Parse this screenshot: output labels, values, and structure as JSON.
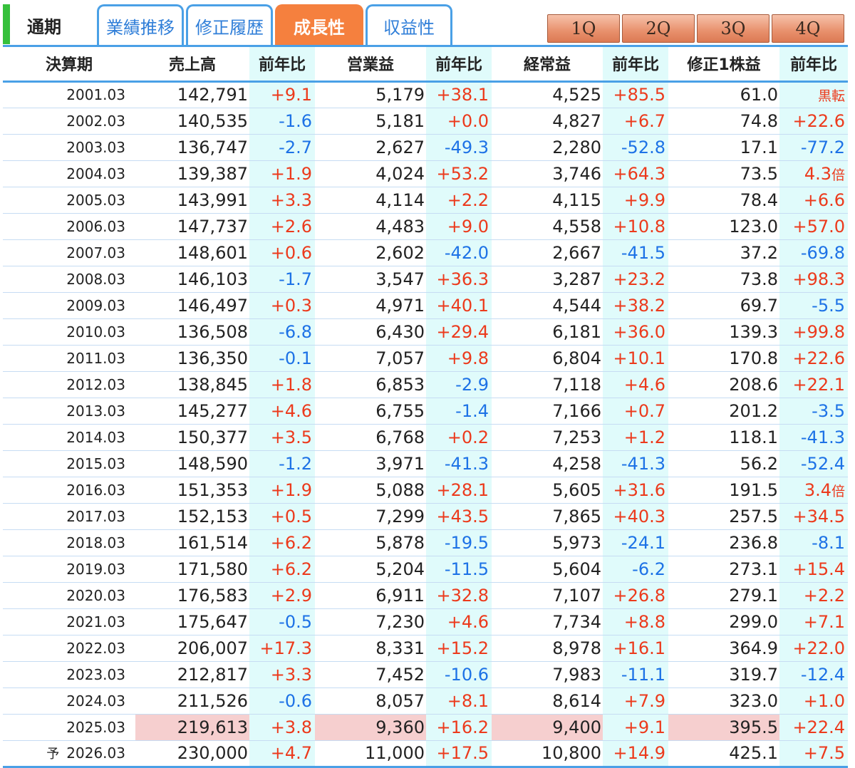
{
  "header": {
    "period_label": "通期",
    "tabs": [
      {
        "label": "業績推移",
        "active": false
      },
      {
        "label": "修正履歴",
        "active": false
      },
      {
        "label": "成長性",
        "active": true
      },
      {
        "label": "収益性",
        "active": false
      }
    ],
    "quarters": [
      "1Q",
      "2Q",
      "3Q",
      "4Q"
    ]
  },
  "colors": {
    "accent_blue": "#4aa0e6",
    "active_tab": "#f5803e",
    "positive": "#ec3a1c",
    "negative": "#1d72e6",
    "yoy_background": "#e0fbfb",
    "highlight_background": "#f6cfcf",
    "indicator_green": "#36c03c"
  },
  "table": {
    "columns": [
      "決算期",
      "売上高",
      "前年比",
      "営業益",
      "前年比",
      "経常益",
      "前年比",
      "修正1株益",
      "前年比"
    ],
    "rows": [
      {
        "period": "2001.03",
        "sales": "142,791",
        "sales_yoy": "+9.1",
        "op": "5,179",
        "op_yoy": "+38.1",
        "ord": "4,525",
        "ord_yoy": "+85.5",
        "eps": "61.0",
        "eps_yoy": "黒転"
      },
      {
        "period": "2002.03",
        "sales": "140,535",
        "sales_yoy": "-1.6",
        "op": "5,181",
        "op_yoy": "+0.0",
        "ord": "4,827",
        "ord_yoy": "+6.7",
        "eps": "74.8",
        "eps_yoy": "+22.6"
      },
      {
        "period": "2003.03",
        "sales": "136,747",
        "sales_yoy": "-2.7",
        "op": "2,627",
        "op_yoy": "-49.3",
        "ord": "2,280",
        "ord_yoy": "-52.8",
        "eps": "17.1",
        "eps_yoy": "-77.2"
      },
      {
        "period": "2004.03",
        "sales": "139,387",
        "sales_yoy": "+1.9",
        "op": "4,024",
        "op_yoy": "+53.2",
        "ord": "3,746",
        "ord_yoy": "+64.3",
        "eps": "73.5",
        "eps_yoy": "4.3倍"
      },
      {
        "period": "2005.03",
        "sales": "143,991",
        "sales_yoy": "+3.3",
        "op": "4,114",
        "op_yoy": "+2.2",
        "ord": "4,115",
        "ord_yoy": "+9.9",
        "eps": "78.4",
        "eps_yoy": "+6.6"
      },
      {
        "period": "2006.03",
        "sales": "147,737",
        "sales_yoy": "+2.6",
        "op": "4,483",
        "op_yoy": "+9.0",
        "ord": "4,558",
        "ord_yoy": "+10.8",
        "eps": "123.0",
        "eps_yoy": "+57.0"
      },
      {
        "period": "2007.03",
        "sales": "148,601",
        "sales_yoy": "+0.6",
        "op": "2,602",
        "op_yoy": "-42.0",
        "ord": "2,667",
        "ord_yoy": "-41.5",
        "eps": "37.2",
        "eps_yoy": "-69.8"
      },
      {
        "period": "2008.03",
        "sales": "146,103",
        "sales_yoy": "-1.7",
        "op": "3,547",
        "op_yoy": "+36.3",
        "ord": "3,287",
        "ord_yoy": "+23.2",
        "eps": "73.8",
        "eps_yoy": "+98.3"
      },
      {
        "period": "2009.03",
        "sales": "146,497",
        "sales_yoy": "+0.3",
        "op": "4,971",
        "op_yoy": "+40.1",
        "ord": "4,544",
        "ord_yoy": "+38.2",
        "eps": "69.7",
        "eps_yoy": "-5.5"
      },
      {
        "period": "2010.03",
        "sales": "136,508",
        "sales_yoy": "-6.8",
        "op": "6,430",
        "op_yoy": "+29.4",
        "ord": "6,181",
        "ord_yoy": "+36.0",
        "eps": "139.3",
        "eps_yoy": "+99.8"
      },
      {
        "period": "2011.03",
        "sales": "136,350",
        "sales_yoy": "-0.1",
        "op": "7,057",
        "op_yoy": "+9.8",
        "ord": "6,804",
        "ord_yoy": "+10.1",
        "eps": "170.8",
        "eps_yoy": "+22.6"
      },
      {
        "period": "2012.03",
        "sales": "138,845",
        "sales_yoy": "+1.8",
        "op": "6,853",
        "op_yoy": "-2.9",
        "ord": "7,118",
        "ord_yoy": "+4.6",
        "eps": "208.6",
        "eps_yoy": "+22.1"
      },
      {
        "period": "2013.03",
        "sales": "145,277",
        "sales_yoy": "+4.6",
        "op": "6,755",
        "op_yoy": "-1.4",
        "ord": "7,166",
        "ord_yoy": "+0.7",
        "eps": "201.2",
        "eps_yoy": "-3.5"
      },
      {
        "period": "2014.03",
        "sales": "150,377",
        "sales_yoy": "+3.5",
        "op": "6,768",
        "op_yoy": "+0.2",
        "ord": "7,253",
        "ord_yoy": "+1.2",
        "eps": "118.1",
        "eps_yoy": "-41.3"
      },
      {
        "period": "2015.03",
        "sales": "148,590",
        "sales_yoy": "-1.2",
        "op": "3,971",
        "op_yoy": "-41.3",
        "ord": "4,258",
        "ord_yoy": "-41.3",
        "eps": "56.2",
        "eps_yoy": "-52.4"
      },
      {
        "period": "2016.03",
        "sales": "151,353",
        "sales_yoy": "+1.9",
        "op": "5,088",
        "op_yoy": "+28.1",
        "ord": "5,605",
        "ord_yoy": "+31.6",
        "eps": "191.5",
        "eps_yoy": "3.4倍"
      },
      {
        "period": "2017.03",
        "sales": "152,153",
        "sales_yoy": "+0.5",
        "op": "7,299",
        "op_yoy": "+43.5",
        "ord": "7,865",
        "ord_yoy": "+40.3",
        "eps": "257.5",
        "eps_yoy": "+34.5"
      },
      {
        "period": "2018.03",
        "sales": "161,514",
        "sales_yoy": "+6.2",
        "op": "5,878",
        "op_yoy": "-19.5",
        "ord": "5,973",
        "ord_yoy": "-24.1",
        "eps": "236.8",
        "eps_yoy": "-8.1"
      },
      {
        "period": "2019.03",
        "sales": "171,580",
        "sales_yoy": "+6.2",
        "op": "5,204",
        "op_yoy": "-11.5",
        "ord": "5,604",
        "ord_yoy": "-6.2",
        "eps": "273.1",
        "eps_yoy": "+15.4"
      },
      {
        "period": "2020.03",
        "sales": "176,583",
        "sales_yoy": "+2.9",
        "op": "6,911",
        "op_yoy": "+32.8",
        "ord": "7,107",
        "ord_yoy": "+26.8",
        "eps": "279.1",
        "eps_yoy": "+2.2"
      },
      {
        "period": "2021.03",
        "sales": "175,647",
        "sales_yoy": "-0.5",
        "op": "7,230",
        "op_yoy": "+4.6",
        "ord": "7,734",
        "ord_yoy": "+8.8",
        "eps": "299.0",
        "eps_yoy": "+7.1"
      },
      {
        "period": "2022.03",
        "sales": "206,007",
        "sales_yoy": "+17.3",
        "op": "8,331",
        "op_yoy": "+15.2",
        "ord": "8,978",
        "ord_yoy": "+16.1",
        "eps": "364.9",
        "eps_yoy": "+22.0"
      },
      {
        "period": "2023.03",
        "sales": "212,817",
        "sales_yoy": "+3.3",
        "op": "7,452",
        "op_yoy": "-10.6",
        "ord": "7,983",
        "ord_yoy": "-11.1",
        "eps": "319.7",
        "eps_yoy": "-12.4"
      },
      {
        "period": "2024.03",
        "sales": "211,526",
        "sales_yoy": "-0.6",
        "op": "8,057",
        "op_yoy": "+8.1",
        "ord": "8,614",
        "ord_yoy": "+7.9",
        "eps": "323.0",
        "eps_yoy": "+1.0"
      },
      {
        "period": "2025.03",
        "sales": "219,613",
        "sales_yoy": "+3.8",
        "op": "9,360",
        "op_yoy": "+16.2",
        "ord": "9,400",
        "ord_yoy": "+9.1",
        "eps": "395.5",
        "eps_yoy": "+22.4",
        "highlight": true
      },
      {
        "period": "2026.03",
        "forecast_mark": "予",
        "sales": "230,000",
        "sales_yoy": "+4.7",
        "op": "11,000",
        "op_yoy": "+17.5",
        "ord": "10,800",
        "ord_yoy": "+14.9",
        "eps": "425.1",
        "eps_yoy": "+7.5"
      }
    ]
  }
}
